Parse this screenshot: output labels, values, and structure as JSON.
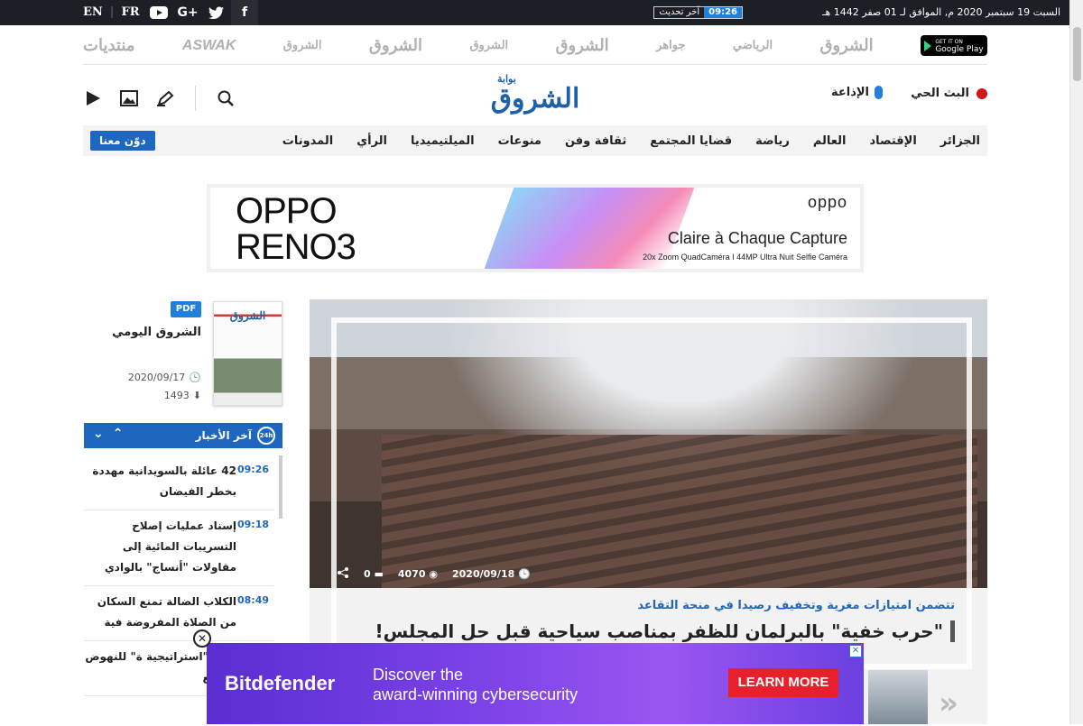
{
  "topbar": {
    "date": "السبت 19 سبتمبر 2020 م, الموافق لـ 01 صفر 1442 هـ",
    "update_label": "آخر تحديث",
    "update_time": "09:26",
    "lang_en": "EN",
    "lang_sep": "|",
    "lang_fr": "FR",
    "social": {
      "youtube": "▶",
      "gplus": "G+",
      "twitter": "🐦",
      "facebook": "f"
    }
  },
  "brands": {
    "gplay_small": "GET IT ON",
    "gplay_label": "Google Play",
    "items": [
      "الشروق",
      "الرياضي",
      "جواهر",
      "الشروق",
      "الشروق",
      "الشروق",
      "ASWAK",
      "منتديات"
    ]
  },
  "header": {
    "logo_prefix": "بوابة",
    "logo_main": "الشروق",
    "live_label": "البث الحي",
    "radio_label": "الإذاعة"
  },
  "nav": {
    "items": [
      "الجزائر",
      "الإقتصاد",
      "العالم",
      "رياضة",
      "قضايا المجتمع",
      "ثقافة وفن",
      "منوعات",
      "الميلتيميديا",
      "الرأي",
      "المدونات"
    ],
    "join": "دوّن معنا"
  },
  "ad_top": {
    "line1": "OPPO",
    "line2": "RENO3",
    "brand": "oppo",
    "tagline": "Claire à Chaque Capture",
    "sub": "20x Zoom QuadCaméra I 44MP Ultra Nuit Selfie Caméra"
  },
  "daily": {
    "pdf": "PDF",
    "title": "الشروق اليومي",
    "date": "2020/09/17",
    "downloads": "1493",
    "cover_title": "الشروق"
  },
  "latest": {
    "title": "آخر الأخبار",
    "clock_label": "24h",
    "items": [
      {
        "time": "09:26",
        "headline": "42 عائلة بالسويدانية مهددة بخطر الفيضان"
      },
      {
        "time": "09:18",
        "headline": "إسناد عمليات إصلاح التسريبات المائية إلى مقاولات \"أنساج\" بالوادي"
      },
      {
        "time": "08:49",
        "headline": "الكلاب الضالة تمنع السكان من الصلاة المفروضة فية"
      },
      {
        "time": "",
        "headline": "تعلن \"استراتيجية ة\" للنهوض بمصنع"
      }
    ]
  },
  "hero": {
    "date": "2020/09/18",
    "views": "4070",
    "comments": "0",
    "kicker": "تتضمن امتيازات مغرية وتخفيف رصيدا في منحة التقاعد",
    "title": "\"حرب خفية\" بالبرلمان للظفر بمناصب سياحية قبل حل المجلس!"
  },
  "ad_bottom": {
    "brand": "Bitdefender",
    "line1": "Discover the",
    "line2": "award-winning cybersecurity",
    "cta": "LEARN MORE"
  }
}
